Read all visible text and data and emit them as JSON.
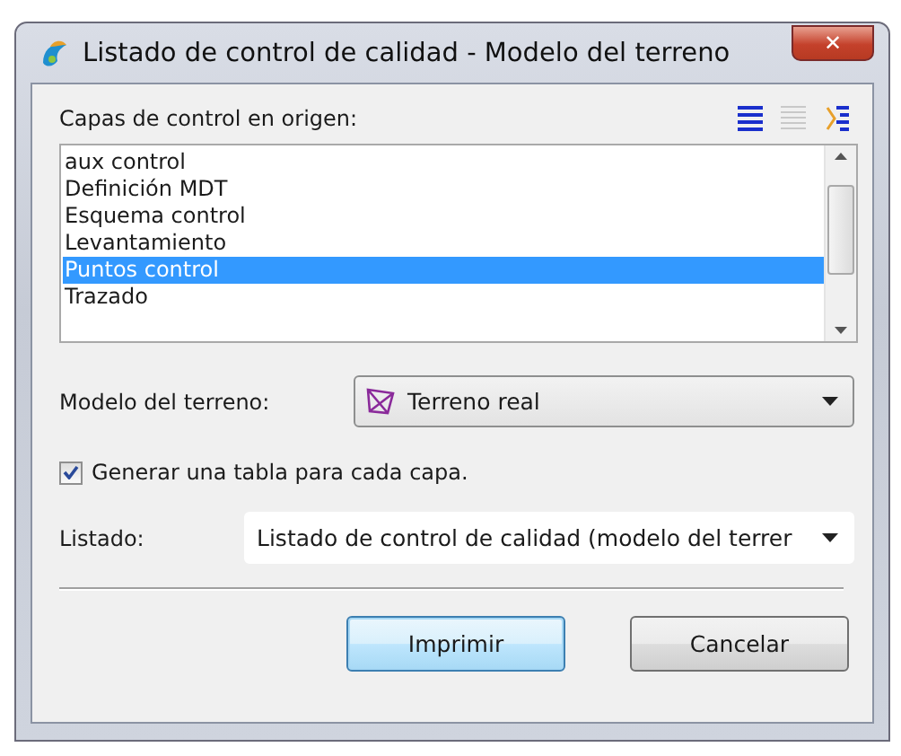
{
  "window": {
    "title": "Listado de control de calidad - Modelo del terreno",
    "close": "✕"
  },
  "layers": {
    "label": "Capas de control en origen:",
    "items": [
      {
        "label": "aux control",
        "selected": false
      },
      {
        "label": "Definición MDT",
        "selected": false
      },
      {
        "label": "Esquema control",
        "selected": false
      },
      {
        "label": "Levantamiento",
        "selected": false
      },
      {
        "label": "Puntos control",
        "selected": true
      },
      {
        "label": "Trazado",
        "selected": false
      }
    ]
  },
  "terrain": {
    "label": "Modelo del terreno:",
    "value": "Terreno real"
  },
  "per_layer_table": {
    "label": "Generar una tabla para cada capa.",
    "checked": true
  },
  "report": {
    "label": "Listado:",
    "value": "Listado de control de calidad (modelo del terrer"
  },
  "buttons": [
    {
      "label": "Imprimir",
      "default": true
    },
    {
      "label": "Cancelar",
      "default": false
    }
  ]
}
